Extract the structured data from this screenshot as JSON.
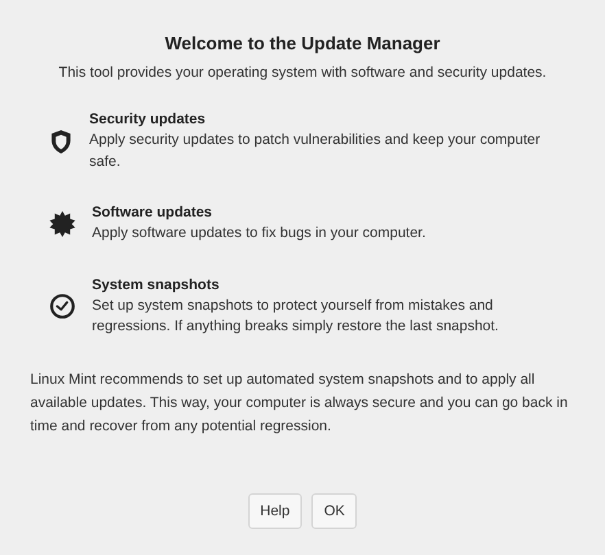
{
  "title": "Welcome to the Update Manager",
  "subtitle": "This tool provides your operating system with software and security updates.",
  "features": [
    {
      "kind": "security",
      "title": "Security updates",
      "description": "Apply security updates to patch vulnerabilities and keep your computer safe."
    },
    {
      "kind": "software",
      "title": "Software updates",
      "description": "Apply software updates to fix bugs in your computer."
    },
    {
      "kind": "snapshots",
      "title": "System snapshots",
      "description": "Set up system snapshots to protect yourself from mistakes and regressions. If anything breaks simply restore the last snapshot."
    }
  ],
  "recommendation": "Linux Mint recommends to set up automated system snapshots and to apply all available updates. This way, your computer is always secure and you can go back in time and recover from any potential regression.",
  "buttons": [
    "Help",
    "OK"
  ]
}
